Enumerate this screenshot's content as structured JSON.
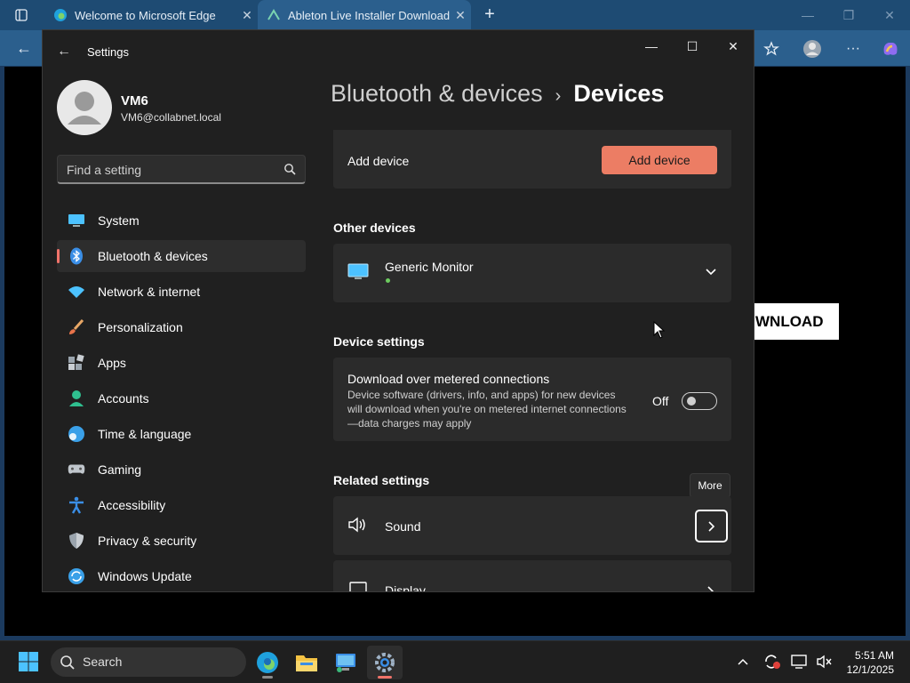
{
  "browser": {
    "tabs": [
      {
        "title": "Welcome to Microsoft Edge"
      },
      {
        "title": "Ableton Live Installer Download U"
      }
    ],
    "page_button_text": "WNLOAD"
  },
  "settings": {
    "window_title": "Settings",
    "user": {
      "name": "VM6",
      "email": "VM6@collabnet.local"
    },
    "search": {
      "placeholder": "Find a setting"
    },
    "nav": [
      {
        "label": "System"
      },
      {
        "label": "Bluetooth & devices"
      },
      {
        "label": "Network & internet"
      },
      {
        "label": "Personalization"
      },
      {
        "label": "Apps"
      },
      {
        "label": "Accounts"
      },
      {
        "label": "Time & language"
      },
      {
        "label": "Gaming"
      },
      {
        "label": "Accessibility"
      },
      {
        "label": "Privacy & security"
      },
      {
        "label": "Windows Update"
      }
    ],
    "breadcrumb": {
      "parent": "Bluetooth & devices",
      "separator": "›",
      "current": "Devices"
    },
    "add_device": {
      "label": "Add device",
      "button": "Add device"
    },
    "other_devices": {
      "heading": "Other devices",
      "device_name": "Generic Monitor"
    },
    "device_settings": {
      "heading": "Device settings",
      "metered_title": "Download over metered connections",
      "metered_desc": "Device software (drivers, info, and apps) for new devices will download when you're on metered internet connections—data charges may apply",
      "toggle_state": "Off"
    },
    "related": {
      "heading": "Related settings",
      "tooltip": "More",
      "items": [
        {
          "label": "Sound"
        },
        {
          "label": "Display"
        }
      ]
    }
  },
  "taskbar": {
    "search_label": "Search",
    "time": "5:51 AM",
    "date": "12/1/2025"
  },
  "colors": {
    "accent": "#ec7d64",
    "selection_indicator": "#f0736a",
    "status_dot": "#6ccb5f"
  }
}
